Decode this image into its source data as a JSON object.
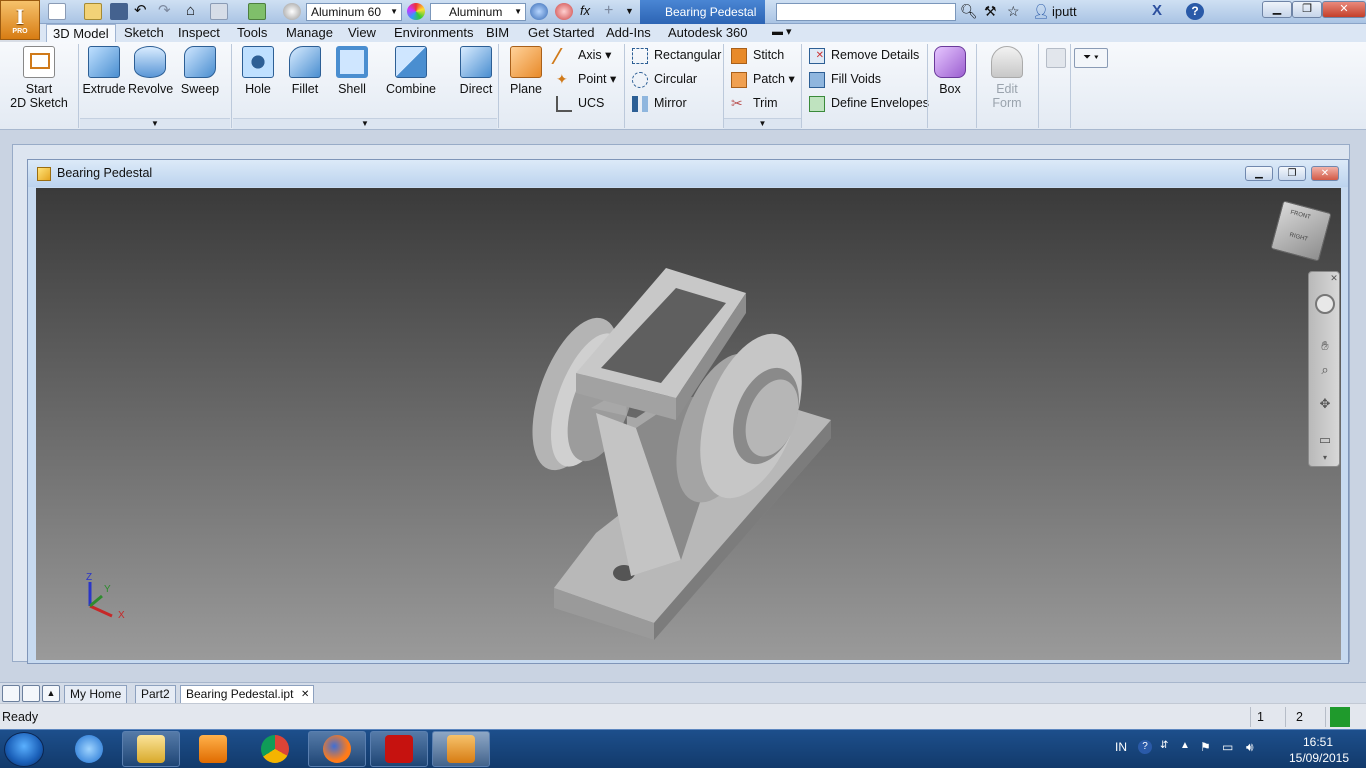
{
  "app": {
    "logo_letter": "I",
    "logo_sub": "PRO",
    "document_title": "Bearing Pedestal",
    "user": "iputt"
  },
  "quick_access": {
    "material": "Aluminum 60",
    "appearance": "Aluminum"
  },
  "tabs": [
    "3D Model",
    "Sketch",
    "Inspect",
    "Tools",
    "Manage",
    "View",
    "Environments",
    "BIM",
    "Get Started",
    "Add-Ins",
    "Autodesk 360"
  ],
  "ribbon": {
    "start_sketch": {
      "line1": "Start",
      "line2": "2D Sketch"
    },
    "create": [
      "Extrude",
      "Revolve",
      "Sweep"
    ],
    "modify": [
      "Hole",
      "Fillet",
      "Shell",
      "Combine"
    ],
    "direct": "Direct",
    "plane": "Plane",
    "work_features": [
      "Axis",
      "Point",
      "UCS"
    ],
    "pattern": [
      "Rectangular",
      "Circular",
      "Mirror"
    ],
    "surface": [
      "Stitch",
      "Patch",
      "Trim"
    ],
    "simplification": [
      "Remove Details",
      "Fill Voids",
      "Define Envelopes"
    ],
    "primitive": "Box",
    "freeform": {
      "line1": "Edit",
      "line2": "Form"
    }
  },
  "viewcube": {
    "top": "FRONT",
    "side": "RIGHT"
  },
  "triad": {
    "x": "X",
    "y": "Y",
    "z": "Z"
  },
  "doc_tabs": [
    "My Home",
    "Part2",
    "Bearing Pedestal.ipt"
  ],
  "status": {
    "text": "Ready",
    "num1": "1",
    "num2": "2"
  },
  "taskbar": {
    "lang": "IN",
    "time": "16:51",
    "date": "15/09/2015"
  },
  "colors": {
    "ribbon_accent": "#2c64b4",
    "viewport_top": "#3a3a3a",
    "viewport_bottom": "#9a9a9a",
    "status_green": "#1f9a2c"
  }
}
